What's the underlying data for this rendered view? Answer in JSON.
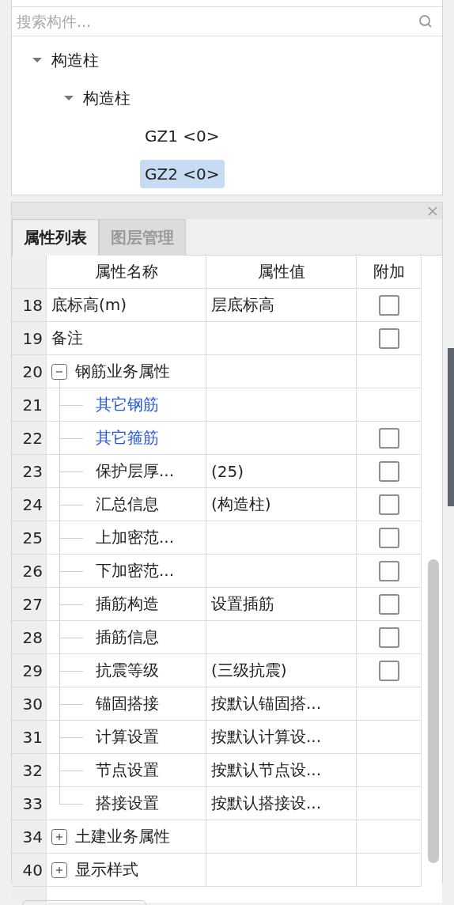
{
  "search": {
    "placeholder": "搜索构件..."
  },
  "tree": [
    {
      "label": "构造柱",
      "expanded": true,
      "selected": false,
      "children": [
        {
          "label": "构造柱",
          "expanded": true,
          "selected": false,
          "children": [
            {
              "label": "GZ1  <0>",
              "selected": false
            },
            {
              "label": "GZ2  <0>",
              "selected": true
            }
          ]
        }
      ]
    }
  ],
  "tabs": [
    {
      "label": "属性列表",
      "selected": true
    },
    {
      "label": "图层管理",
      "selected": false
    }
  ],
  "table": {
    "columns": [
      "属性名称",
      "属性值",
      "附加"
    ],
    "rows": [
      {
        "no": "18",
        "kind": "plain",
        "name": "底标高(m)",
        "value": "层底标高",
        "checked": false
      },
      {
        "no": "19",
        "kind": "plain",
        "name": "备注",
        "checked": false
      },
      {
        "no": "20",
        "kind": "group",
        "name": "钢筋业务属性",
        "expanded": true
      },
      {
        "no": "21",
        "kind": "link",
        "name": "其它钢筋"
      },
      {
        "no": "22",
        "kind": "link",
        "name": "其它箍筋",
        "checked": false
      },
      {
        "no": "23",
        "kind": "child",
        "name": "保护层厚...",
        "value": "(25)",
        "checked": false
      },
      {
        "no": "24",
        "kind": "child",
        "name": "汇总信息",
        "value": "(构造柱)",
        "checked": false
      },
      {
        "no": "25",
        "kind": "child",
        "name": "上加密范...",
        "checked": false
      },
      {
        "no": "26",
        "kind": "child",
        "name": "下加密范...",
        "checked": false
      },
      {
        "no": "27",
        "kind": "child",
        "name": "插筋构造",
        "value": "设置插筋",
        "checked": false
      },
      {
        "no": "28",
        "kind": "child",
        "name": "插筋信息",
        "checked": false
      },
      {
        "no": "29",
        "kind": "child",
        "name": "抗震等级",
        "value": "(三级抗震)",
        "checked": false
      },
      {
        "no": "30",
        "kind": "child",
        "name": "锚固搭接",
        "value": "按默认锚固搭..."
      },
      {
        "no": "31",
        "kind": "child",
        "name": "计算设置",
        "value": "按默认计算设..."
      },
      {
        "no": "32",
        "kind": "child",
        "name": "节点设置",
        "value": "按默认节点设..."
      },
      {
        "no": "33",
        "kind": "last",
        "name": "搭接设置",
        "value": "按默认搭接设..."
      },
      {
        "no": "34",
        "kind": "group",
        "name": "土建业务属性",
        "expanded": false
      },
      {
        "no": "40",
        "kind": "group",
        "name": "显示样式",
        "expanded": false
      }
    ]
  }
}
